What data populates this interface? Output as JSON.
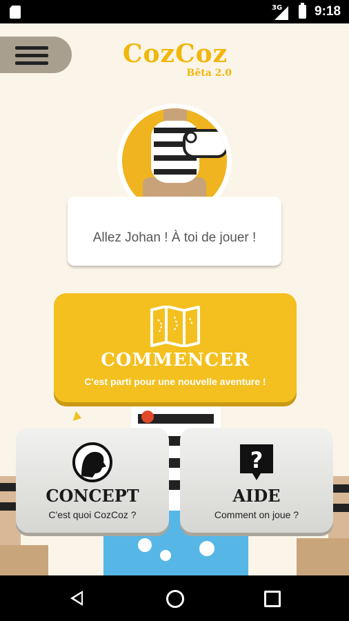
{
  "status_bar": {
    "network": "3G",
    "time": "9:18"
  },
  "app": {
    "name": "CozCoz",
    "version": "Bêta 2.0"
  },
  "greeting": "Allez Johan ! À toi de jouer !",
  "buttons": {
    "commencer": {
      "title": "COMMENCER",
      "subtitle": "C'est parti pour une nouvelle aventure !"
    },
    "concept": {
      "title": "CONCEPT",
      "subtitle": "C'est quoi CozCoz ?"
    },
    "aide": {
      "title": "AIDE",
      "subtitle": "Comment on joue ?"
    }
  },
  "colors": {
    "accent": "#f3c01f",
    "background": "#fbf4e8",
    "logo": "#f0b70b"
  }
}
